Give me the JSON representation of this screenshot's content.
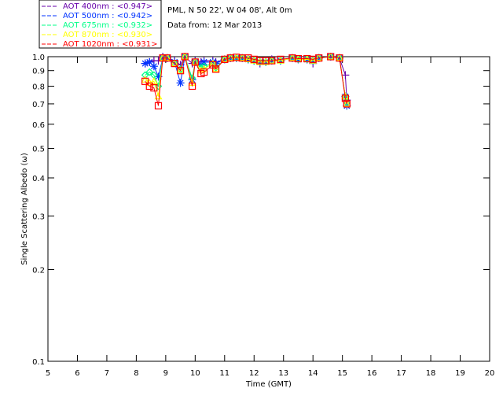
{
  "chart_data": {
    "type": "line",
    "title_lines": [
      "PML, N 50 22', W 04 08', Alt 0m",
      "Data from: 12 Mar 2013"
    ],
    "xlabel": "Time (GMT)",
    "ylabel": "Single Scattering Albedo (ω)",
    "xlim": [
      5,
      20
    ],
    "ylim": [
      0.1,
      1.0
    ],
    "yscale": "log",
    "xticks": [
      "5",
      "6",
      "7",
      "8",
      "9",
      "10",
      "11",
      "12",
      "13",
      "14",
      "15",
      "16",
      "17",
      "18",
      "19",
      "20"
    ],
    "yticks": [
      "0.1",
      "0.2",
      "0.3",
      "0.4",
      "0.5",
      "0.6",
      "0.7",
      "0.8",
      "0.9",
      "1.0"
    ],
    "legend_placement": "top-left",
    "x": [
      8.3,
      8.45,
      8.6,
      8.75,
      8.9,
      9.05,
      9.3,
      9.5,
      9.65,
      9.9,
      10.0,
      10.2,
      10.3,
      10.6,
      10.7,
      11.0,
      11.2,
      11.4,
      11.6,
      11.8,
      12.0,
      12.2,
      12.4,
      12.6,
      12.9,
      13.3,
      13.5,
      13.8,
      14.0,
      14.2,
      14.6,
      14.9,
      15.1,
      15.15
    ],
    "series": [
      {
        "name": "AOT  400nm : <0.947>",
        "color": "#6600aa",
        "marker": "plus",
        "values": [
          0.95,
          0.96,
          0.97,
          0.97,
          1.0,
          0.99,
          0.97,
          0.94,
          1.0,
          0.95,
          0.97,
          0.96,
          0.97,
          0.97,
          0.96,
          0.98,
          0.99,
          0.99,
          0.99,
          0.98,
          0.97,
          0.95,
          0.97,
          0.98,
          0.97,
          0.99,
          0.98,
          0.98,
          0.95,
          0.99,
          1.0,
          0.99,
          0.87,
          0.72
        ]
      },
      {
        "name": "AOT  500nm : <0.942>",
        "color": "#0033ff",
        "marker": "asterisk",
        "values": [
          0.95,
          0.96,
          0.93,
          0.86,
          0.99,
          0.99,
          0.96,
          0.82,
          1.0,
          0.84,
          0.96,
          0.94,
          0.96,
          0.96,
          0.95,
          0.98,
          0.99,
          0.99,
          0.99,
          0.98,
          0.97,
          0.96,
          0.96,
          0.97,
          0.97,
          0.99,
          0.98,
          0.98,
          0.97,
          0.99,
          1.0,
          0.99,
          0.74,
          0.69
        ]
      },
      {
        "name": "AOT  675nm : <0.932>",
        "color": "#00ff88",
        "marker": "diamond",
        "values": [
          0.87,
          0.89,
          0.87,
          0.8,
          0.99,
          0.99,
          0.95,
          0.91,
          1.0,
          0.85,
          0.96,
          0.92,
          0.93,
          0.95,
          0.92,
          0.98,
          0.99,
          0.99,
          0.99,
          0.98,
          0.97,
          0.96,
          0.96,
          0.97,
          0.97,
          0.99,
          0.98,
          0.98,
          0.97,
          0.99,
          1.0,
          0.99,
          0.74,
          0.71
        ]
      },
      {
        "name": "AOT  870nm : <0.930>",
        "color": "#ffff00",
        "marker": "triangle",
        "values": [
          0.84,
          0.82,
          0.83,
          0.74,
          0.99,
          0.99,
          0.95,
          0.9,
          1.0,
          0.82,
          0.96,
          0.9,
          0.91,
          0.95,
          0.91,
          0.98,
          0.99,
          0.99,
          0.99,
          0.98,
          0.97,
          0.96,
          0.96,
          0.97,
          0.97,
          0.99,
          0.98,
          0.98,
          0.97,
          0.99,
          1.0,
          0.99,
          0.74,
          0.7
        ]
      },
      {
        "name": "AOT 1020nm : <0.931>",
        "color": "#ff0000",
        "marker": "square",
        "values": [
          0.83,
          0.8,
          0.79,
          0.69,
          0.99,
          0.99,
          0.95,
          0.9,
          1.0,
          0.8,
          0.96,
          0.88,
          0.89,
          0.94,
          0.91,
          0.98,
          0.99,
          0.995,
          0.99,
          0.99,
          0.98,
          0.97,
          0.97,
          0.97,
          0.98,
          0.99,
          0.985,
          0.985,
          0.98,
          0.99,
          1.0,
          0.99,
          0.73,
          0.7
        ]
      }
    ]
  }
}
